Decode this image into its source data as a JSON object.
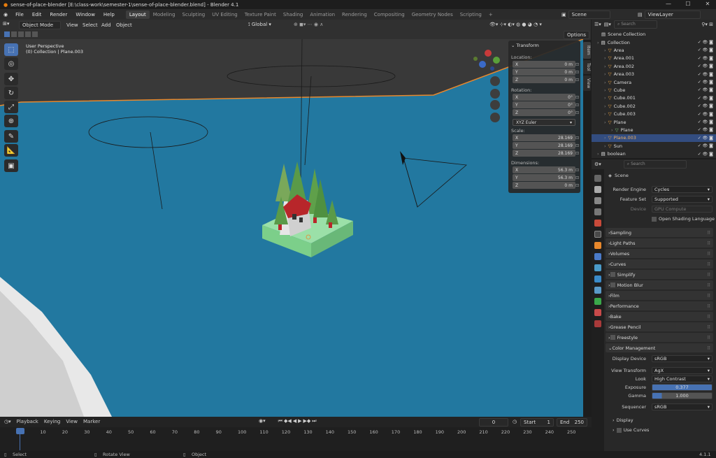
{
  "window": {
    "title": "sense-of-place-blender [E:\\class-work\\semester-1\\sense-of-place-blender.blend] - Blender 4.1",
    "min": "—",
    "max": "☐",
    "close": "✕"
  },
  "menus": [
    "File",
    "Edit",
    "Render",
    "Window",
    "Help"
  ],
  "workspaces": [
    "Layout",
    "Modeling",
    "Sculpting",
    "UV Editing",
    "Texture Paint",
    "Shading",
    "Animation",
    "Rendering",
    "Compositing",
    "Geometry Nodes",
    "Scripting",
    "+"
  ],
  "scene": {
    "label": "Scene",
    "viewlayer": "ViewLayer"
  },
  "viewport_header": {
    "mode": "Object Mode",
    "view": "View",
    "select": "Select",
    "add": "Add",
    "object": "Object",
    "orientation": "Global",
    "options": "Options"
  },
  "overlay_text": {
    "line1": "User Perspective",
    "line2": "(0) Collection | Plane.003"
  },
  "npanel": {
    "title": "Transform",
    "location_label": "Location:",
    "location": [
      {
        "axis": "X",
        "value": "0 m"
      },
      {
        "axis": "Y",
        "value": "0 m"
      },
      {
        "axis": "Z",
        "value": "0 m"
      }
    ],
    "rotation_label": "Rotation:",
    "rotation": [
      {
        "axis": "X",
        "value": "0°"
      },
      {
        "axis": "Y",
        "value": "0°"
      },
      {
        "axis": "Z",
        "value": "0°"
      }
    ],
    "rotation_mode": "XYZ Euler",
    "scale_label": "Scale:",
    "scale": [
      {
        "axis": "X",
        "value": "28.169"
      },
      {
        "axis": "Y",
        "value": "28.169"
      },
      {
        "axis": "Z",
        "value": "28.169"
      }
    ],
    "dimensions_label": "Dimensions:",
    "dimensions": [
      {
        "axis": "X",
        "value": "56.3 m"
      },
      {
        "axis": "Y",
        "value": "56.3 m"
      },
      {
        "axis": "Z",
        "value": "0 m"
      }
    ]
  },
  "side_tabs": [
    "Item",
    "Tool",
    "View"
  ],
  "outliner": {
    "search": "Search",
    "root": "Scene Collection",
    "items": [
      {
        "name": "Collection",
        "indent": 0,
        "color": "#e0e0e0"
      },
      {
        "name": "Area",
        "indent": 1,
        "color": "#e8a040"
      },
      {
        "name": "Area.001",
        "indent": 1,
        "color": "#e8a040"
      },
      {
        "name": "Area.002",
        "indent": 1,
        "color": "#e8a040"
      },
      {
        "name": "Area.003",
        "indent": 1,
        "color": "#e8a040"
      },
      {
        "name": "Camera",
        "indent": 1,
        "color": "#e8a040"
      },
      {
        "name": "Cube",
        "indent": 1,
        "color": "#e8a040"
      },
      {
        "name": "Cube.001",
        "indent": 1,
        "color": "#e8a040"
      },
      {
        "name": "Cube.002",
        "indent": 1,
        "color": "#e8a040"
      },
      {
        "name": "Cube.003",
        "indent": 1,
        "color": "#e8a040"
      },
      {
        "name": "Plane",
        "indent": 1,
        "color": "#e8a040"
      },
      {
        "name": "Plane",
        "indent": 2,
        "color": "#7cc47c"
      },
      {
        "name": "Plane.003",
        "indent": 1,
        "color": "#e8a040"
      },
      {
        "name": "Sun",
        "indent": 1,
        "color": "#e8a040"
      },
      {
        "name": "boolean",
        "indent": 0,
        "color": "#e0e0e0"
      }
    ]
  },
  "properties": {
    "search": "Search",
    "scene": "Scene",
    "render_engine_label": "Render Engine",
    "render_engine": "Cycles",
    "feature_set_label": "Feature Set",
    "feature_set": "Supported",
    "device_label": "Device",
    "device": "GPU Compute",
    "osl": "Open Shading Language",
    "sections": [
      "Sampling",
      "Light Paths",
      "Volumes",
      "Curves",
      "Simplify",
      "Motion Blur",
      "Film",
      "Performance",
      "Bake",
      "Grease Pencil",
      "Freestyle",
      "Color Management"
    ],
    "display_device_label": "Display Device",
    "display_device": "sRGB",
    "view_transform_label": "View Transform",
    "view_transform": "AgX",
    "look_label": "Look",
    "look": "High Contrast",
    "exposure_label": "Exposure",
    "exposure": "0.377",
    "gamma_label": "Gamma",
    "gamma": "1.000",
    "sequencer_label": "Sequencer",
    "sequencer": "sRGB",
    "display": "Display",
    "use_curves": "Use Curves"
  },
  "timeline": {
    "playback": "Playback",
    "keying": "Keying",
    "view": "View",
    "marker": "Marker",
    "frame": "0",
    "start_label": "Start",
    "start": "1",
    "end_label": "End",
    "end": "250",
    "ticks": [
      "0",
      "10",
      "20",
      "30",
      "40",
      "50",
      "60",
      "70",
      "80",
      "90",
      "100",
      "110",
      "120",
      "130",
      "140",
      "150",
      "160",
      "170",
      "180",
      "190",
      "200",
      "210",
      "220",
      "230",
      "240",
      "250"
    ]
  },
  "status": {
    "select": "Select",
    "rotate": "Rotate View",
    "object": "Object",
    "version": "4.1.1"
  },
  "colors": {
    "accent": "#4772b3",
    "selection": "#334d80",
    "water": "#2278a0",
    "grass": "#7ccf8a"
  }
}
